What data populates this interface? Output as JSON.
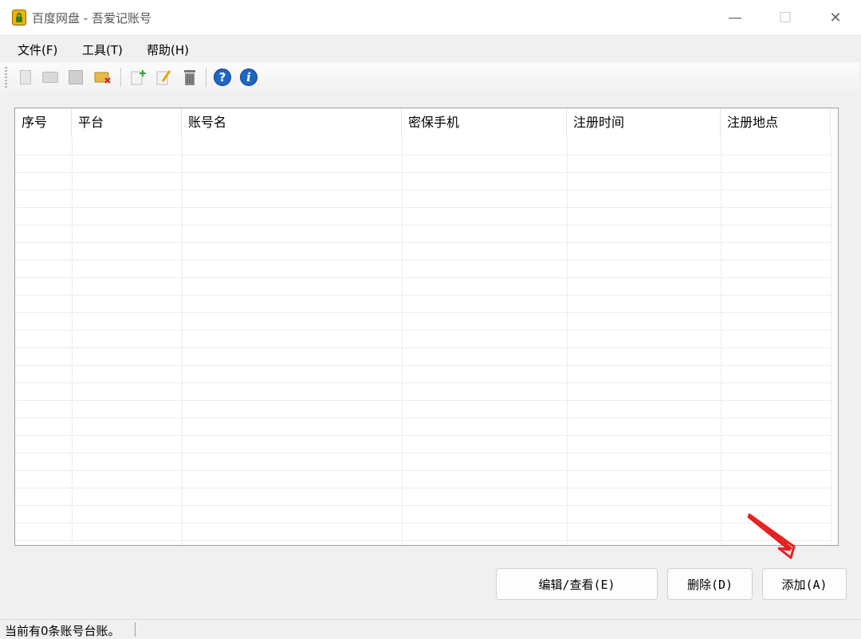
{
  "window": {
    "title": "百度网盘 - 吾爱记账号",
    "minimize_glyph": "—",
    "maximize_glyph": "☐",
    "close_glyph": "✕"
  },
  "menu": {
    "items": [
      {
        "label": "文件(F)"
      },
      {
        "label": "工具(T)"
      },
      {
        "label": "帮助(H)"
      }
    ]
  },
  "toolbar": {
    "icons": [
      "new-file-icon",
      "open-folder-icon",
      "save-icon",
      "delete-folder-icon",
      "add-item-icon",
      "edit-item-icon",
      "trash-icon",
      "help-icon",
      "info-icon"
    ],
    "help_glyph": "?",
    "info_glyph": "i"
  },
  "table": {
    "columns": [
      "序号",
      "平台",
      "账号名",
      "密保手机",
      "注册时间",
      "注册地点"
    ],
    "rows": []
  },
  "buttons": {
    "edit": "编辑/查看(E)",
    "delete": "删除(D)",
    "add": "添加(A)"
  },
  "status": {
    "text": "当前有0条账号台账。"
  },
  "colors": {
    "accent_blue": "#1e66c4",
    "arrow_red": "#e52020"
  }
}
